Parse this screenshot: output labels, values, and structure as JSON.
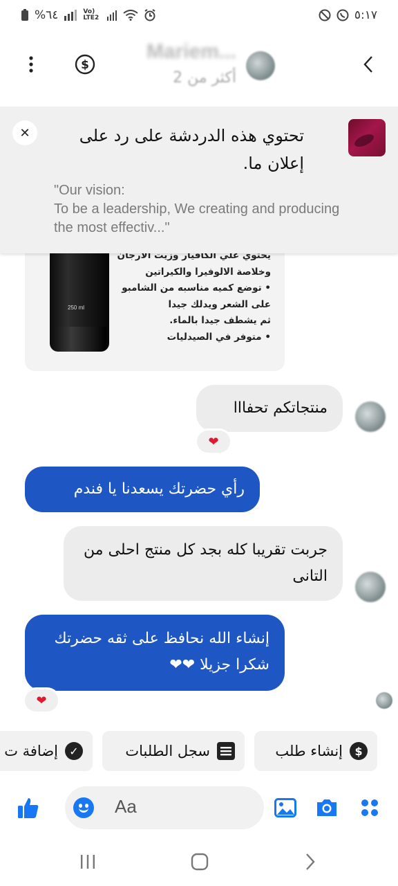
{
  "status_bar": {
    "battery": "%٦٤",
    "network": "Vo) LTE2",
    "time": "٥:١٧"
  },
  "header": {
    "contact_name": "Mariem...",
    "subtitle": "أكثر من 2",
    "back_icon": "chevron-left-icon",
    "menu_icon": "vertical-dots-icon",
    "payment_icon": "dollar-circle-icon"
  },
  "reply_banner": {
    "title": "تحتوي هذه الدردشة على رد على إعلان ما.",
    "quote": "\"Our vision:\nTo be a leadership, We creating and producing the most effectiv...\"",
    "close_label": "✕"
  },
  "product_image": {
    "bottle_label": "250 ml",
    "lines": [
      "يحتوي علي الكافيار وزيت الارجان",
      "وخلاصة الالوفيرا والكيراتين",
      "• توضع كميه مناسبه من الشامبو",
      "على الشعر ويدلك جيدا",
      "ثم يشطف جيدا بالماء.",
      "• متوفر في الصيدليات"
    ]
  },
  "messages": [
    {
      "direction": "incoming",
      "text": "منتجاتكم تحفااا",
      "reaction": "❤"
    },
    {
      "direction": "outgoing",
      "text": "رأي حضرتك يسعدنا يا فندم"
    },
    {
      "direction": "incoming",
      "text": "جربت تقريبا كله بجد كل منتج احلى من التانى"
    },
    {
      "direction": "outgoing",
      "text": "إنشاء الله نحافظ على ثقه حضرتك شكرا جزيلا ❤❤",
      "reaction": "❤"
    }
  ],
  "quick_replies": [
    {
      "label": "إنشاء طلب",
      "icon": "dollar-circle-icon"
    },
    {
      "label": "سجل الطلبات",
      "icon": "list-icon"
    },
    {
      "label": "إضافة ت",
      "icon": "check-circle-icon"
    }
  ],
  "composer": {
    "placeholder": "Aa",
    "accent_color": "#1877f2"
  },
  "colors": {
    "outgoing_bubble": "#1e57c4",
    "incoming_bubble": "#ececec",
    "reaction_heart": "#e0192f"
  }
}
